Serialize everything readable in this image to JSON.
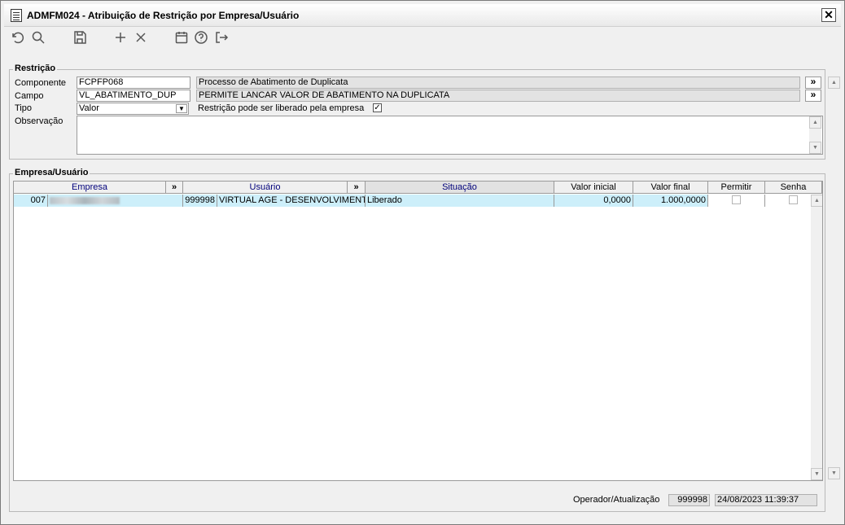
{
  "window": {
    "title": "ADMFM024 - Atribuição de Restrição por Empresa/Usuário",
    "close_label": "✕"
  },
  "toolbar": {
    "icons": [
      "undo-icon",
      "search-icon",
      "save-icon",
      "add-icon",
      "delete-icon",
      "calendar-icon",
      "help-icon",
      "exit-icon"
    ]
  },
  "restricao": {
    "section_title": "Restrição",
    "componente_label": "Componente",
    "componente_value": "FCPFP068",
    "componente_desc": "Processo de Abatimento de Duplicata",
    "campo_label": "Campo",
    "campo_value": "VL_ABATIMENTO_DUP",
    "campo_desc": "PERMITE LANCAR VALOR DE ABATIMENTO NA DUPLICATA",
    "tipo_label": "Tipo",
    "tipo_value": "Valor",
    "liberado_label": "Restrição pode ser liberado pela empresa",
    "liberado_checked": "✓",
    "observacao_label": "Observação",
    "observacao_value": "",
    "more_label": "»"
  },
  "empresa_usuario": {
    "section_title": "Empresa/Usuário",
    "columns": {
      "empresa": "Empresa",
      "usuario": "Usuário",
      "situacao": "Situação",
      "valor_inicial": "Valor inicial",
      "valor_final": "Valor final",
      "permitir": "Permitir",
      "senha": "Senha",
      "more": "»"
    },
    "rows": [
      {
        "empresa_code": "007",
        "usuario_code": "999998",
        "usuario_name": "VIRTUAL AGE - DESENVOLVIMENTO",
        "situacao": "Liberado",
        "valor_inicial": "0,0000",
        "valor_final": "1.000,0000"
      }
    ]
  },
  "footer": {
    "operador_label": "Operador/Atualização",
    "operador_value": "999998",
    "atualizacao_value": "24/08/2023 11:39:37"
  }
}
